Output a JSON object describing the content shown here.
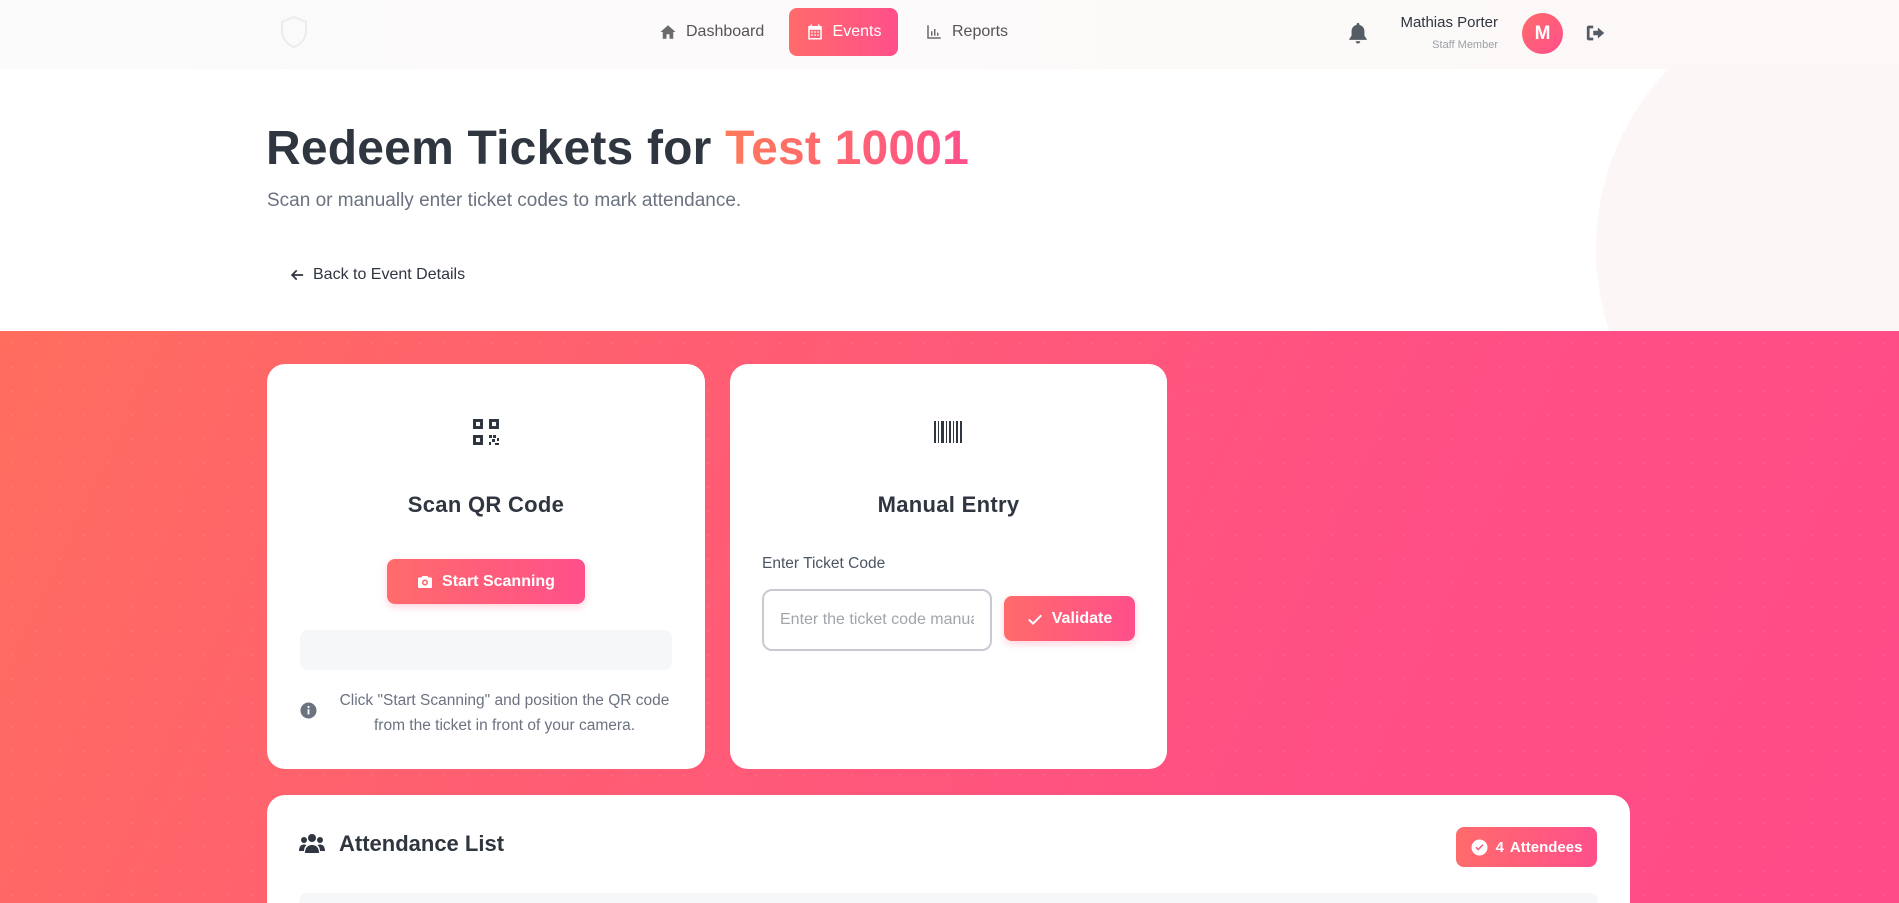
{
  "nav": {
    "items": [
      {
        "label": "Dashboard",
        "icon": "home-icon",
        "active": false
      },
      {
        "label": "Events",
        "icon": "calendar-icon",
        "active": true
      },
      {
        "label": "Reports",
        "icon": "chart-icon",
        "active": false
      }
    ],
    "user": {
      "name": "Mathias Porter",
      "role": "Staff Member",
      "avatar_letter": "M"
    }
  },
  "hero": {
    "title_prefix": "Redeem Tickets for",
    "title_event": "Test 10001",
    "subtitle": "Scan or manually enter ticket codes to mark attendance.",
    "back_label": "Back to Event Details"
  },
  "scan_card": {
    "icon": "qrcode-icon",
    "title": "Scan QR Code",
    "button_label": "Start Scanning",
    "help_text": "Click \"Start Scanning\" and position the QR code from the ticket in front of your camera."
  },
  "manual_card": {
    "icon": "barcode-icon",
    "title": "Manual Entry",
    "field_label": "Enter Ticket Code",
    "input_placeholder": "Enter the ticket code manually",
    "input_value": "",
    "button_label": "Validate"
  },
  "attendance": {
    "title": "Attendance List",
    "count": "4",
    "count_label": "Attendees"
  },
  "colors": {
    "accent_start": "#ff6b6b",
    "accent_end": "#ff4f8b",
    "text_dark": "#2f3640"
  }
}
